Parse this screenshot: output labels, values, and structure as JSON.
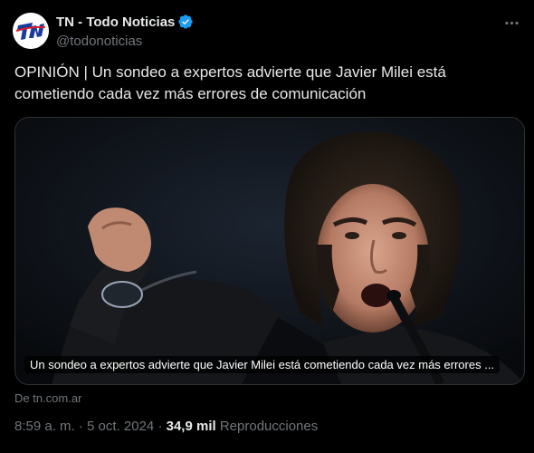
{
  "account": {
    "display_name": "TN - Todo Noticias",
    "handle": "@todonoticias",
    "avatar_text": "TN",
    "verified_color": "#1d9bf0"
  },
  "post": {
    "text": "OPINIÓN | Un sondeo a expertos advierte que Javier Milei está cometiendo cada vez más errores de comunicación"
  },
  "card": {
    "caption": "Un sondeo a expertos advierte que Javier Milei está cometiendo cada vez más errores ...",
    "source": "De tn.com.ar"
  },
  "meta": {
    "time": "8:59 a. m.",
    "separator": "·",
    "date": "5 oct. 2024",
    "views_count": "34,9 mil",
    "views_label": "Reproducciones"
  },
  "colors": {
    "background": "#000000",
    "text": "#e7e9ea",
    "secondary": "#71767b",
    "border": "#2f3336",
    "brand_blue": "#1a3a9c"
  },
  "icons": [
    "verified-badge-icon",
    "more-options-icon"
  ]
}
